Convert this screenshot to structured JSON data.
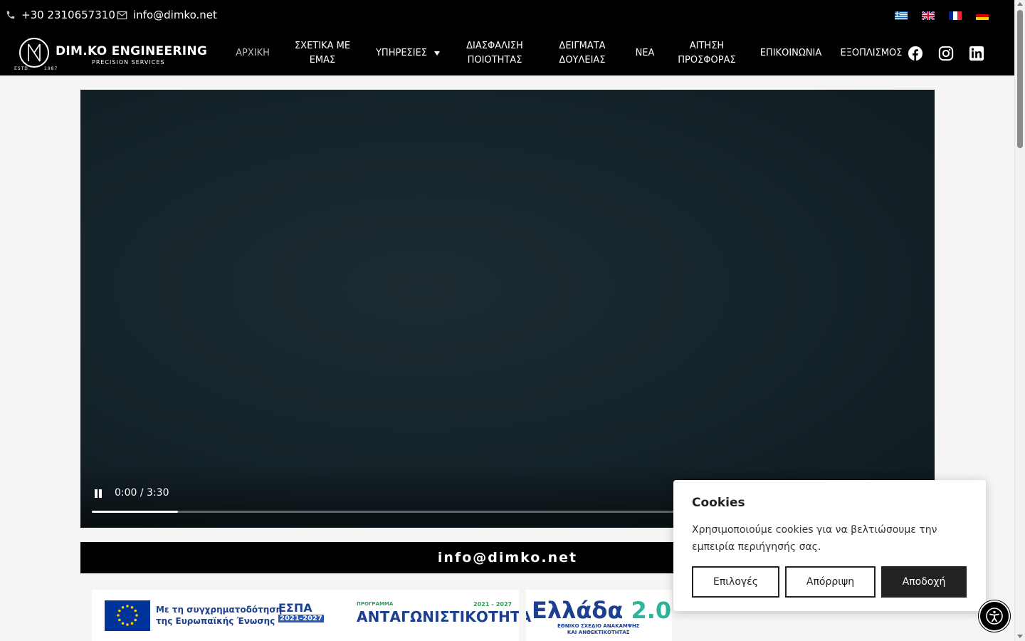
{
  "topbar": {
    "phone": "+30 2310657310",
    "email": "info@dimko.net",
    "icons": [
      "phone-icon",
      "envelope-icon"
    ],
    "languages": [
      "flag-gr",
      "flag-en",
      "flag-fr",
      "flag-de"
    ]
  },
  "logo": {
    "title": "DIM.KO ENGINEERING",
    "subtitle": "PRECISION SERVICES",
    "estd": "ESTD.",
    "year": "1987"
  },
  "nav": {
    "items": [
      {
        "label": "ΑΡΧΙΚΗ",
        "active": true
      },
      {
        "label": "ΣΧΕΤΙΚΑ ΜΕ\nΕΜΑΣ"
      },
      {
        "label": "ΥΠΗΡΕΣΙΕΣ",
        "dropdown": true
      },
      {
        "label": "ΔΙΑΣΦΑΛΙΣΗ\nΠΟΙΟΤΗΤΑΣ"
      },
      {
        "label": "ΔΕΙΓΜΑΤΑ\nΔΟΥΛΕΙΑΣ"
      },
      {
        "label": "ΝΕΑ"
      },
      {
        "label": "ΑΙΤΗΣΗ\nΠΡΟΣΦΟΡΑΣ"
      },
      {
        "label": "ΕΠΙΚΟΙΝΩΝΙΑ"
      },
      {
        "label": "ΕΞΟΠΛΙΣΜΟΣ"
      }
    ],
    "social": [
      "facebook-icon",
      "instagram-icon",
      "linkedin-icon"
    ]
  },
  "video": {
    "time": "0:00 / 3:30",
    "progress": 0.104
  },
  "email_bar": {
    "text": "info@dimko.net"
  },
  "banner": {
    "eu_line1": "Με τη συγχρηματοδότηση",
    "eu_line2": "της Ευρωπαϊκής Ένωσης",
    "espa_title": "ΕΣΠΑ",
    "espa_years": "2021-2027",
    "program_label": "ΠΡΟΓΡΑΜΜΑ",
    "program_years": "2021 – 2027",
    "program_title": "ΑΝΤΑΓΩΝΙΣΤΙΚΟΤΗΤΑ",
    "ellada_word": "Ελλάδα",
    "ellada_num": "2.0",
    "ellada_sub1": "ΕΘΝΙΚΟ ΣΧΕΔΙΟ ΑΝΑΚΑΜΨΗΣ",
    "ellada_sub2": "ΚΑΙ ΑΝΘΕΚΤΙΚΟΤΗΤΑΣ"
  },
  "cookie": {
    "title": "Cookies",
    "text": "Χρησιμοποιούμε cookies για να βελτιώσουμε την εμπειρία περιήγησής σας.",
    "options_label": "Επιλογές",
    "reject_label": "Απόρριψη",
    "accept_label": "Αποδοχή"
  },
  "colors": {
    "header_bg": "#000000",
    "accent_blue": "#1d3f8f",
    "video_bg": "#15232a"
  }
}
